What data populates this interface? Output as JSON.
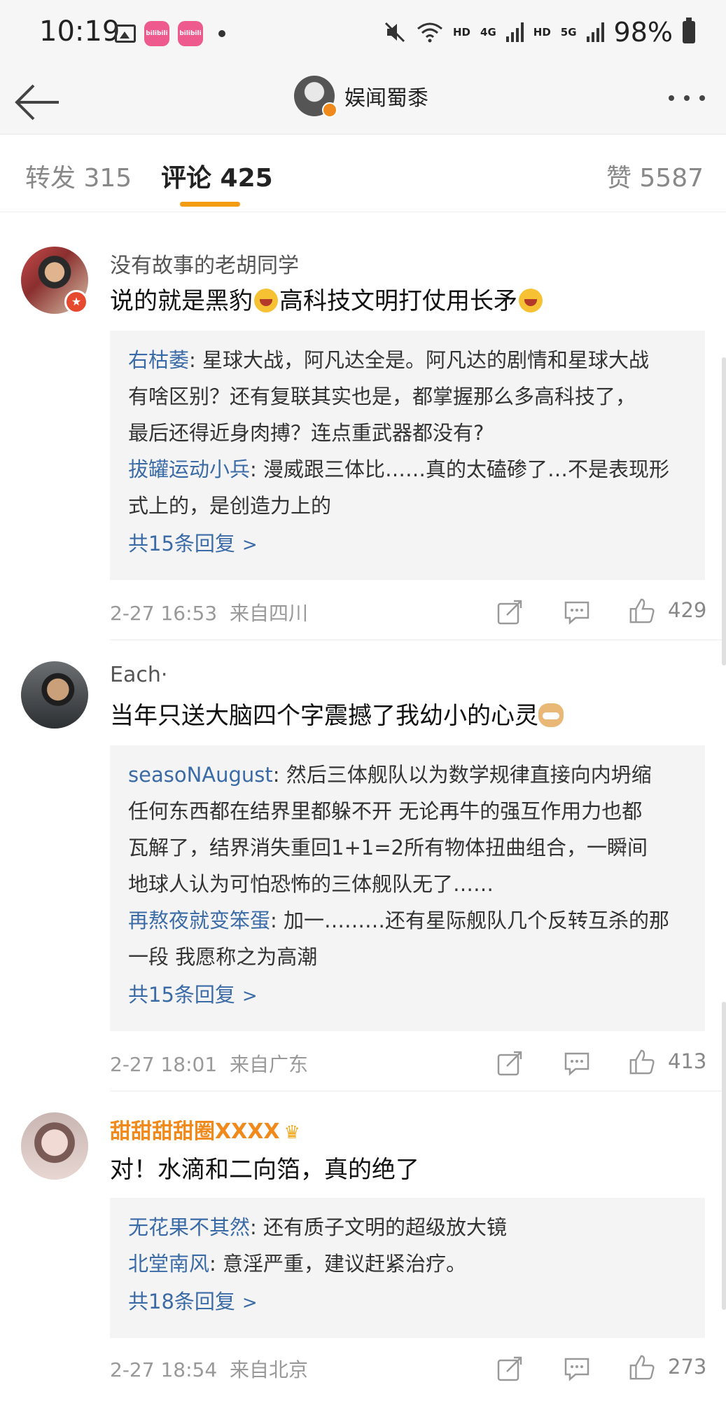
{
  "status_bar": {
    "time": "10:19",
    "app_icon_text": "bilibili",
    "network_1": "HD",
    "network_2": "4G",
    "network_3": "HD",
    "network_4": "5G",
    "battery": "98%"
  },
  "nav": {
    "title": "娱闻蜀黍"
  },
  "tabs": {
    "repost": "转发 315",
    "comment": "评论 425",
    "likes": "赞 5587"
  },
  "comments": [
    {
      "username": "没有故事的老胡同学",
      "text": "说的就是黑豹",
      "text_2": "高科技文明打仗用长矛",
      "replies": [
        {
          "name": "右枯萎",
          "sep": ": ",
          "line1": "星球大战，阿凡达全是。阿凡达的剧情和星球大战",
          "line2": "有啥区别？还有复联其实也是，都掌握那么多高科技了，",
          "line3": "最后还得近身肉搏？连点重武器都没有?"
        },
        {
          "name": "拔罐运动小兵",
          "sep": ": ",
          "line1": "漫威跟三体比……真的太磕碜了…不是表现形",
          "line2": "式上的，是创造力上的"
        }
      ],
      "more_replies": "共15条回复",
      "time": "2-27 16:53",
      "location": "来自四川",
      "likes": "429"
    },
    {
      "username": "Each·",
      "text": "当年只送大脑四个字震撼了我幼小的心灵",
      "replies": [
        {
          "name": "seasoNAugust",
          "sep": ": ",
          "line1": "然后三体舰队以为数学规律直接向内坍缩",
          "line2": "任何东西都在结界里都躲不开 无论再牛的强互作用力也都",
          "line3": "瓦解了，结界消失重回1+1=2所有物体扭曲组合，一瞬间",
          "line4": "地球人认为可怕恐怖的三体舰队无了……"
        },
        {
          "name": "再熬夜就变笨蛋",
          "sep": ": ",
          "line1": "加一………还有星际舰队几个反转互杀的那",
          "line2": "一段 我愿称之为高潮"
        }
      ],
      "more_replies": "共15条回复",
      "time": "2-27 18:01",
      "location": "来自广东",
      "likes": "413"
    },
    {
      "username": "甜甜甜甜圈XXXX",
      "text": "对！水滴和二向箔，真的绝了",
      "replies": [
        {
          "name": "无花果不其然",
          "sep": ": ",
          "line1": "还有质子文明的超级放大镜"
        },
        {
          "name": "北堂南风",
          "sep": ": ",
          "line1": "意淫严重，建议赶紧治疗。"
        }
      ],
      "more_replies": "共18条回复",
      "time": "2-27 18:54",
      "location": "来自北京",
      "likes": "273"
    }
  ]
}
